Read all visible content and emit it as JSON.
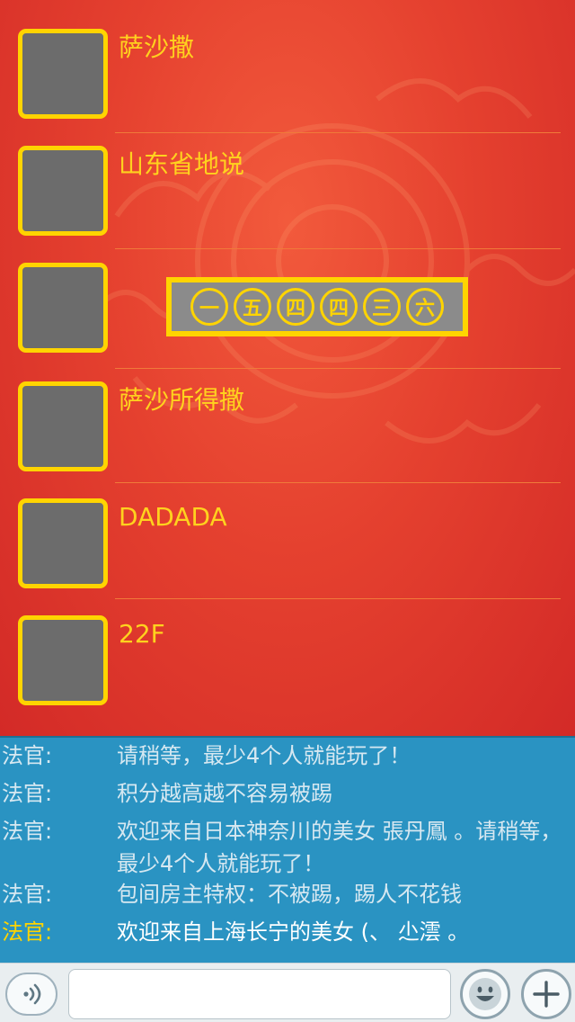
{
  "players": [
    {
      "name": "萨沙撒"
    },
    {
      "name": "山东省地说"
    },
    {
      "name": ""
    },
    {
      "name": "萨沙所得撒"
    },
    {
      "name": "DADADA"
    },
    {
      "name": "22F"
    }
  ],
  "banner": {
    "coins": [
      "一",
      "五",
      "四",
      "四",
      "三",
      "六"
    ]
  },
  "chat": {
    "messages": [
      {
        "speaker": "法官:",
        "text": "请稍等，最少4个人就能玩了！"
      },
      {
        "speaker": "法官:",
        "text": "积分越高越不容易被踢"
      },
      {
        "speaker": "法官:",
        "text": "欢迎来自日本神奈川的美女 張丹鳳 。请稍等，最少4个人就能玩了！"
      },
      {
        "speaker": "法官:",
        "text": "包间房主特权：不被踢，踢人不花钱"
      },
      {
        "speaker": "法官:",
        "text": "欢迎来自上海长宁的美女 (、 尐澐 。"
      }
    ]
  },
  "input_bar": {
    "placeholder": "",
    "voice_icon": "voice-icon",
    "emoji_icon": "emoji-icon",
    "plus_icon": "plus-icon"
  },
  "colors": {
    "accent_yellow": "#ffd400",
    "chat_blue": "#2a93c2",
    "background_red": "#e5412f"
  }
}
